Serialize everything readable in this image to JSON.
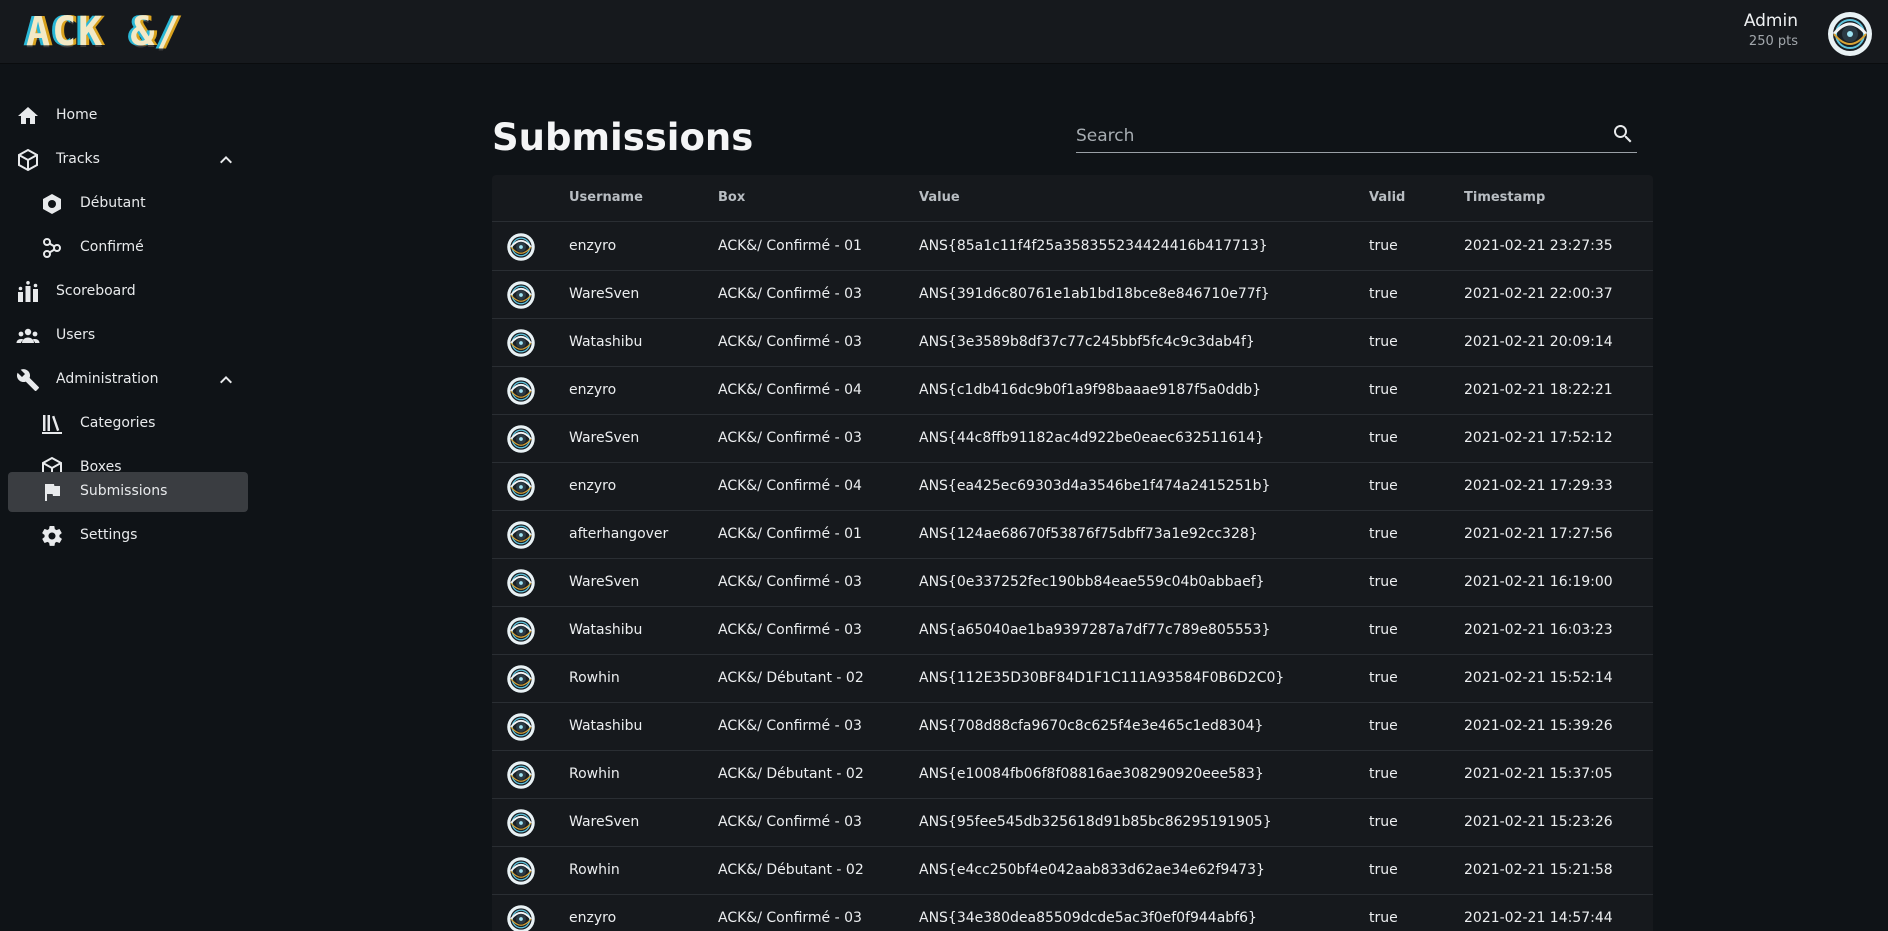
{
  "header": {
    "logo_text": "ACK &/",
    "user_name": "Admin",
    "user_points": "250 pts"
  },
  "sidebar": {
    "items": [
      {
        "label": "Home",
        "icon": "home-icon",
        "level": 0
      },
      {
        "label": "Tracks",
        "icon": "cube-icon",
        "level": 0,
        "expanded": true
      },
      {
        "label": "Débutant",
        "icon": "hexagon-icon",
        "level": 1
      },
      {
        "label": "Confirmé",
        "icon": "molecule-icon",
        "level": 1
      },
      {
        "label": "Scoreboard",
        "icon": "scoreboard-icon",
        "level": 0
      },
      {
        "label": "Users",
        "icon": "users-icon",
        "level": 0
      },
      {
        "label": "Administration",
        "icon": "wrench-icon",
        "level": 0,
        "expanded": true
      },
      {
        "label": "Categories",
        "icon": "books-icon",
        "level": 1
      },
      {
        "label": "Boxes",
        "icon": "cube-icon",
        "level": 1
      },
      {
        "label": "Submissions",
        "icon": "flag-icon",
        "level": 1,
        "active": true
      },
      {
        "label": "Settings",
        "icon": "gear-icon",
        "level": 1
      }
    ]
  },
  "main": {
    "title": "Submissions",
    "search_label": "Search",
    "columns": [
      "Username",
      "Box",
      "Value",
      "Valid",
      "Timestamp"
    ],
    "rows": [
      {
        "username": "enzyro",
        "box": "ACK&/ Confirmé - 01",
        "value": "ANS{85a1c11f4f25a358355234424416b417713}",
        "valid": "true",
        "timestamp": "2021-02-21 23:27:35"
      },
      {
        "username": "WareSven",
        "box": "ACK&/ Confirmé - 03",
        "value": "ANS{391d6c80761e1ab1bd18bce8e846710e77f}",
        "valid": "true",
        "timestamp": "2021-02-21 22:00:37"
      },
      {
        "username": "Watashibu",
        "box": "ACK&/ Confirmé - 03",
        "value": "ANS{3e3589b8df37c77c245bbf5fc4c9c3dab4f}",
        "valid": "true",
        "timestamp": "2021-02-21 20:09:14"
      },
      {
        "username": "enzyro",
        "box": "ACK&/ Confirmé - 04",
        "value": "ANS{c1db416dc9b0f1a9f98baaae9187f5a0ddb}",
        "valid": "true",
        "timestamp": "2021-02-21 18:22:21"
      },
      {
        "username": "WareSven",
        "box": "ACK&/ Confirmé - 03",
        "value": "ANS{44c8ffb91182ac4d922be0eaec632511614}",
        "valid": "true",
        "timestamp": "2021-02-21 17:52:12"
      },
      {
        "username": "enzyro",
        "box": "ACK&/ Confirmé - 04",
        "value": "ANS{ea425ec69303d4a3546be1f474a2415251b}",
        "valid": "true",
        "timestamp": "2021-02-21 17:29:33"
      },
      {
        "username": "afterhangover",
        "box": "ACK&/ Confirmé - 01",
        "value": "ANS{124ae68670f53876f75dbff73a1e92cc328}",
        "valid": "true",
        "timestamp": "2021-02-21 17:27:56"
      },
      {
        "username": "WareSven",
        "box": "ACK&/ Confirmé - 03",
        "value": "ANS{0e337252fec190bb84eae559c04b0abbaef}",
        "valid": "true",
        "timestamp": "2021-02-21 16:19:00"
      },
      {
        "username": "Watashibu",
        "box": "ACK&/ Confirmé - 03",
        "value": "ANS{a65040ae1ba9397287a7df77c789e805553}",
        "valid": "true",
        "timestamp": "2021-02-21 16:03:23"
      },
      {
        "username": "Rowhin",
        "box": "ACK&/ Débutant - 02",
        "value": "ANS{112E35D30BF84D1F1C111A93584F0B6D2C0}",
        "valid": "true",
        "timestamp": "2021-02-21 15:52:14"
      },
      {
        "username": "Watashibu",
        "box": "ACK&/ Confirmé - 03",
        "value": "ANS{708d88cfa9670c8c625f4e3e465c1ed8304}",
        "valid": "true",
        "timestamp": "2021-02-21 15:39:26"
      },
      {
        "username": "Rowhin",
        "box": "ACK&/ Débutant - 02",
        "value": "ANS{e10084fb06f8f08816ae308290920eee583}",
        "valid": "true",
        "timestamp": "2021-02-21 15:37:05"
      },
      {
        "username": "WareSven",
        "box": "ACK&/ Confirmé - 03",
        "value": "ANS{95fee545db325618d91b85bc86295191905}",
        "valid": "true",
        "timestamp": "2021-02-21 15:23:26"
      },
      {
        "username": "Rowhin",
        "box": "ACK&/ Débutant - 02",
        "value": "ANS{e4cc250bf4e042aab833d62ae34e62f9473}",
        "valid": "true",
        "timestamp": "2021-02-21 15:21:58"
      },
      {
        "username": "enzyro",
        "box": "ACK&/ Confirmé - 03",
        "value": "ANS{34e380dea85509dcde5ac3f0ef0f944abf6}",
        "valid": "true",
        "timestamp": "2021-02-21 14:57:44"
      }
    ]
  }
}
